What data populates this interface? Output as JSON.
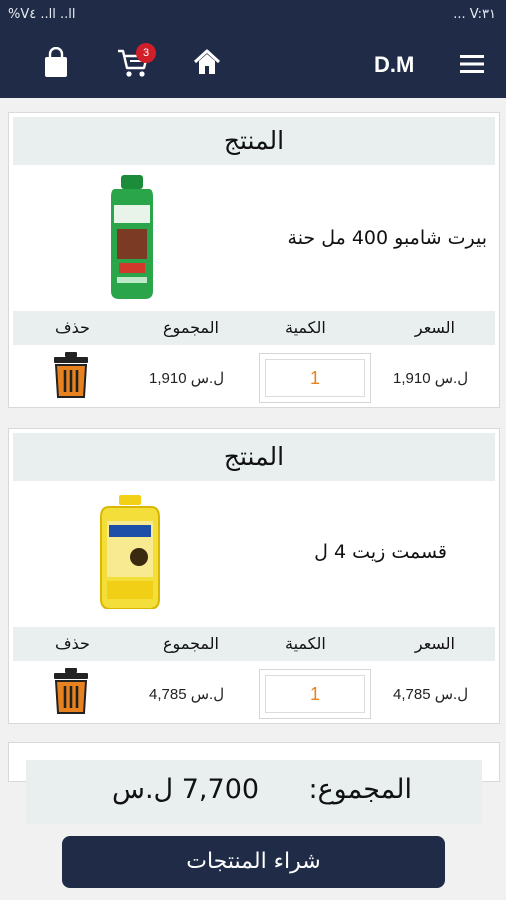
{
  "status_bar": {
    "left_text": "%V٤ ..ll ..ll",
    "right_text": "... V:٣١"
  },
  "header": {
    "brand": "D.M",
    "cart_count": "3"
  },
  "products": [
    {
      "header_label": "المنتج",
      "name": "بيرت شامبو 400 مل حنة",
      "col_price": "السعر",
      "col_qty": "الكمية",
      "col_total": "المجموع",
      "col_delete": "حذف",
      "price": "1,910 ل.س",
      "quantity": "1",
      "total": "1,910 ل.س"
    },
    {
      "header_label": "المنتج",
      "name": "قسمت زيت 4 ل",
      "col_price": "السعر",
      "col_qty": "الكمية",
      "col_total": "المجموع",
      "col_delete": "حذف",
      "price": "4,785 ل.س",
      "quantity": "1",
      "total": "4,785 ل.س"
    }
  ],
  "summary": {
    "label": "المجموع:",
    "value": "7,700 ل.س"
  },
  "buy_button_label": "شراء المنتجات",
  "colors": {
    "navy": "#1f2b47",
    "accent_orange": "#e8821e",
    "badge_red": "#d11f2a"
  },
  "icons": [
    "bag-icon",
    "cart-icon",
    "home-icon",
    "menu-icon",
    "trash-icon"
  ]
}
